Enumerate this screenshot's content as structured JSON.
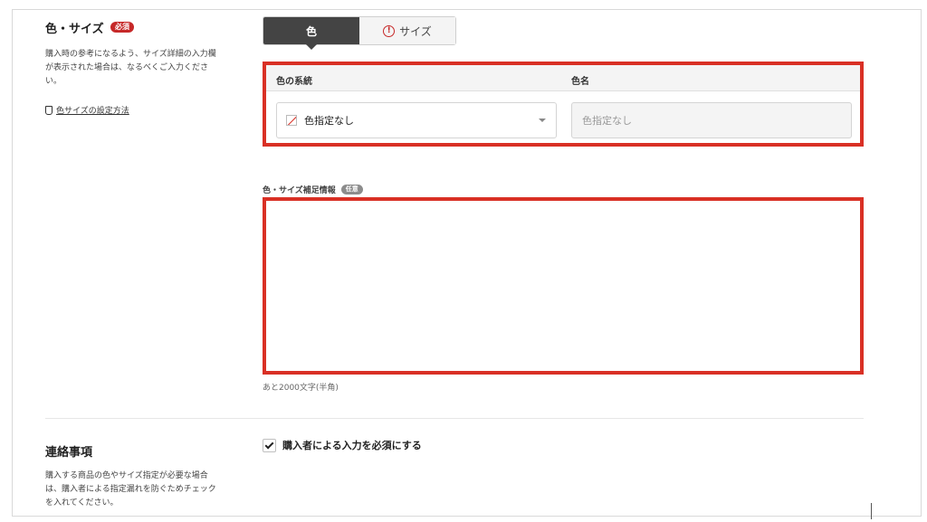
{
  "color_size": {
    "title": "色・サイズ",
    "required_badge": "必須",
    "description_lines": [
      "購入時の参考になるよう、サイズ詳細の入力欄",
      "が表示された場合は、なるべくご入力くださ",
      "い。"
    ],
    "guide_link": "色サイズの設定方法",
    "tabs": [
      {
        "label": "色",
        "active": true
      },
      {
        "label": "サイズ",
        "active": false,
        "warning": true,
        "warning_icon": "exclamation-circle-icon"
      }
    ],
    "table": {
      "col_family_header": "色の系統",
      "col_name_header": "色名",
      "family_value": "色指定なし",
      "name_placeholder": "色指定なし"
    },
    "supplement": {
      "label": "色・サイズ補足情報",
      "optional_badge": "任意",
      "value": "",
      "counter": "あと2000文字(半角)"
    }
  },
  "contact": {
    "title": "連絡事項",
    "description_lines": [
      "購入する商品の色やサイズ指定が必要な場合",
      "は、購入者による指定漏れを防ぐためチェック",
      "を入れてください。"
    ],
    "checkbox_label": "購入者による入力を必須にする",
    "checked": true
  },
  "colors": {
    "accent_red": "#d93025",
    "required_red": "#c62828",
    "active_tab": "#444444",
    "optional_gray": "#8c8c8c"
  }
}
